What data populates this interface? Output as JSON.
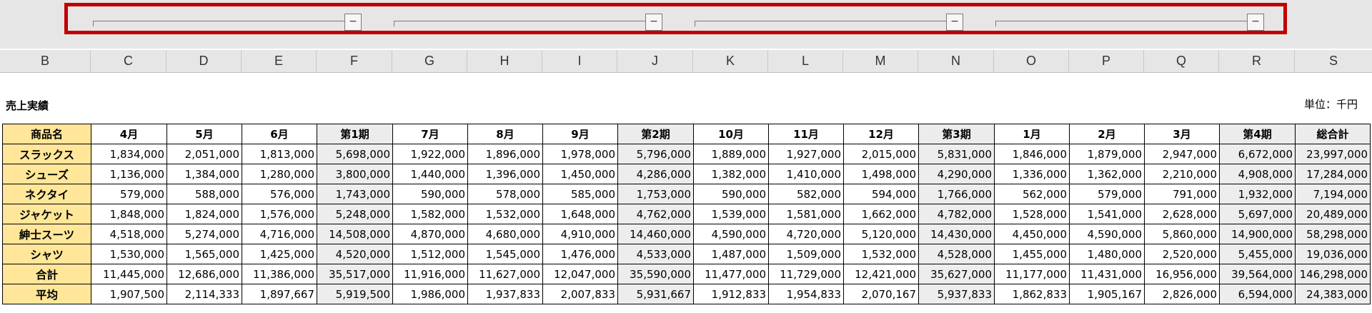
{
  "outline": {
    "collapse_symbol": "−"
  },
  "columns": [
    "B",
    "C",
    "D",
    "E",
    "F",
    "G",
    "H",
    "I",
    "J",
    "K",
    "L",
    "M",
    "N",
    "O",
    "P",
    "Q",
    "R",
    "S"
  ],
  "sheet": {
    "title": "売上実績",
    "unit": "単位：千円"
  },
  "table": {
    "headers": [
      "商品名",
      "4月",
      "5月",
      "6月",
      "第1期",
      "7月",
      "8月",
      "9月",
      "第2期",
      "10月",
      "11月",
      "12月",
      "第3期",
      "1月",
      "2月",
      "3月",
      "第4期",
      "総合計"
    ],
    "rows": [
      [
        "スラックス",
        "1,834,000",
        "2,051,000",
        "1,813,000",
        "5,698,000",
        "1,922,000",
        "1,896,000",
        "1,978,000",
        "5,796,000",
        "1,889,000",
        "1,927,000",
        "2,015,000",
        "5,831,000",
        "1,846,000",
        "1,879,000",
        "2,947,000",
        "6,672,000",
        "23,997,000"
      ],
      [
        "シューズ",
        "1,136,000",
        "1,384,000",
        "1,280,000",
        "3,800,000",
        "1,440,000",
        "1,396,000",
        "1,450,000",
        "4,286,000",
        "1,382,000",
        "1,410,000",
        "1,498,000",
        "4,290,000",
        "1,336,000",
        "1,362,000",
        "2,210,000",
        "4,908,000",
        "17,284,000"
      ],
      [
        "ネクタイ",
        "579,000",
        "588,000",
        "576,000",
        "1,743,000",
        "590,000",
        "578,000",
        "585,000",
        "1,753,000",
        "590,000",
        "582,000",
        "594,000",
        "1,766,000",
        "562,000",
        "579,000",
        "791,000",
        "1,932,000",
        "7,194,000"
      ],
      [
        "ジャケット",
        "1,848,000",
        "1,824,000",
        "1,576,000",
        "5,248,000",
        "1,582,000",
        "1,532,000",
        "1,648,000",
        "4,762,000",
        "1,539,000",
        "1,581,000",
        "1,662,000",
        "4,782,000",
        "1,528,000",
        "1,541,000",
        "2,628,000",
        "5,697,000",
        "20,489,000"
      ],
      [
        "紳士スーツ",
        "4,518,000",
        "5,274,000",
        "4,716,000",
        "14,508,000",
        "4,870,000",
        "4,680,000",
        "4,910,000",
        "14,460,000",
        "4,590,000",
        "4,720,000",
        "5,120,000",
        "14,430,000",
        "4,450,000",
        "4,590,000",
        "5,860,000",
        "14,900,000",
        "58,298,000"
      ],
      [
        "シャツ",
        "1,530,000",
        "1,565,000",
        "1,425,000",
        "4,520,000",
        "1,512,000",
        "1,545,000",
        "1,476,000",
        "4,533,000",
        "1,487,000",
        "1,509,000",
        "1,532,000",
        "4,528,000",
        "1,455,000",
        "1,480,000",
        "2,520,000",
        "5,455,000",
        "19,036,000"
      ],
      [
        "合計",
        "11,445,000",
        "12,686,000",
        "11,386,000",
        "35,517,000",
        "11,916,000",
        "11,627,000",
        "12,047,000",
        "35,590,000",
        "11,477,000",
        "11,729,000",
        "12,421,000",
        "35,627,000",
        "11,177,000",
        "11,431,000",
        "16,956,000",
        "39,564,000",
        "146,298,000"
      ],
      [
        "平均",
        "1,907,500",
        "2,114,333",
        "1,897,667",
        "5,919,500",
        "1,986,000",
        "1,937,833",
        "2,007,833",
        "5,931,667",
        "1,912,833",
        "1,954,833",
        "2,070,167",
        "5,937,833",
        "1,862,833",
        "1,905,167",
        "2,826,000",
        "6,594,000",
        "24,383,000"
      ]
    ]
  },
  "colors": {
    "outline_highlight": "#c00000",
    "name_fill": "#ffe699",
    "subtotal_fill": "#ededed"
  }
}
